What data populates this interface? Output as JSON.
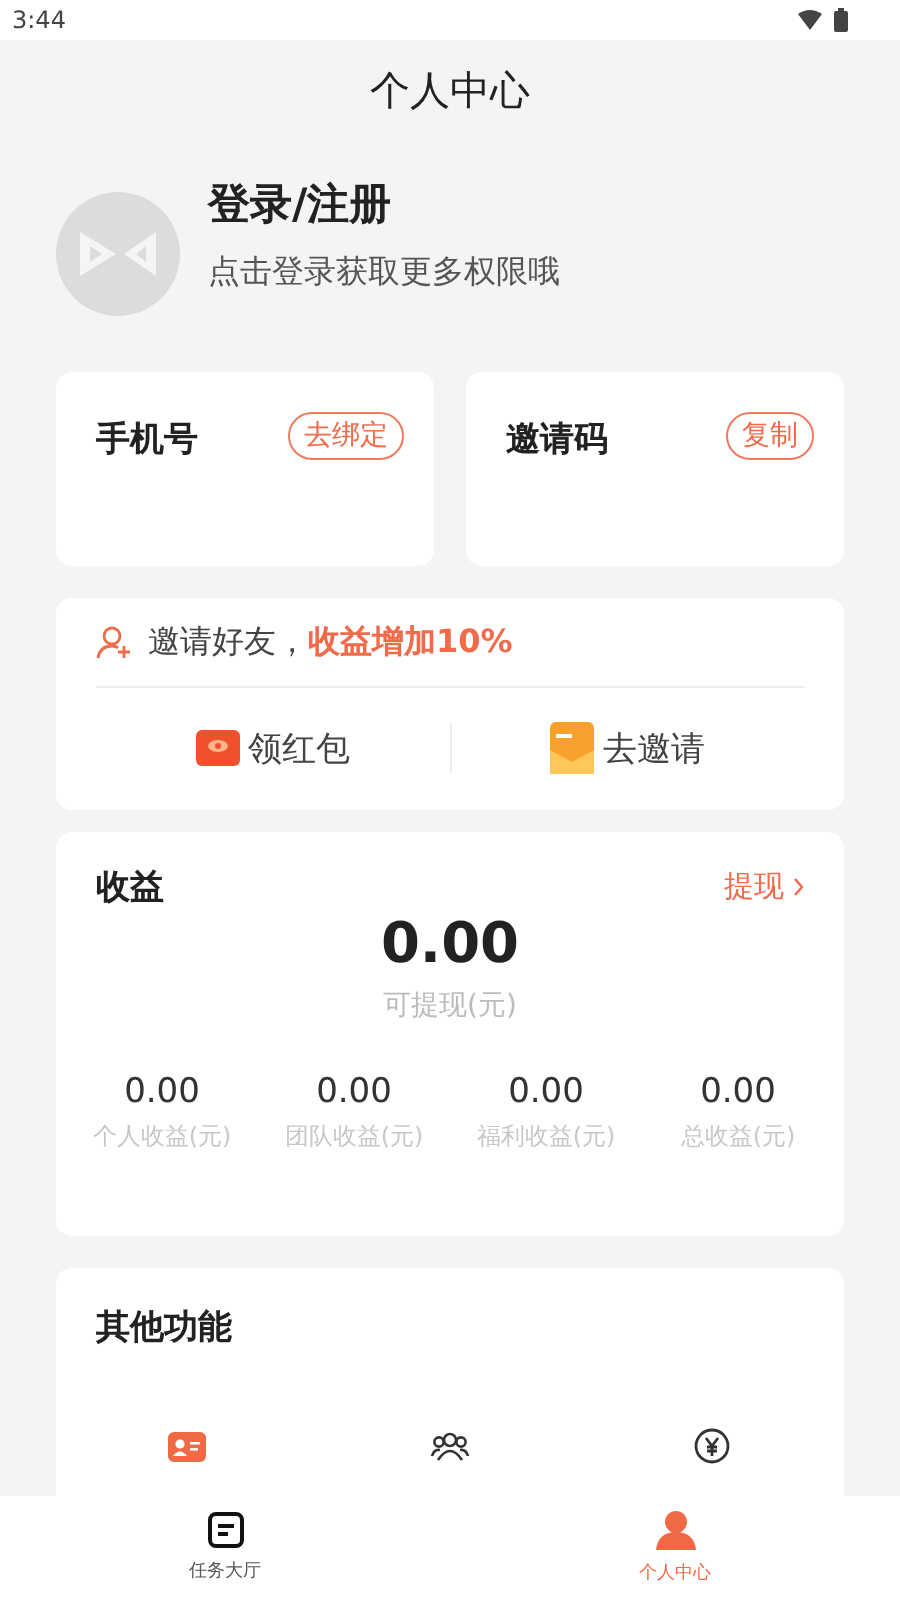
{
  "status_bar": {
    "time": "3:44"
  },
  "header": {
    "title": "个人中心"
  },
  "profile": {
    "title": "登录/注册",
    "subtitle": "点击登录获取更多权限哦"
  },
  "bind_cards": [
    {
      "label": "手机号",
      "action": "去绑定"
    },
    {
      "label": "邀请码",
      "action": "复制"
    }
  ],
  "invite": {
    "text": "邀请好友，**收益增加10%**",
    "actions": [
      {
        "label": "领红包",
        "kind": "red-packet"
      },
      {
        "label": "去邀请",
        "kind": "envelope"
      }
    ]
  },
  "earnings": {
    "title": "收益",
    "link": "提现",
    "amount": "0.00",
    "amount_label": "可提现(元)",
    "stats": [
      {
        "value": "0.00",
        "label": "个人收益(元)"
      },
      {
        "value": "0.00",
        "label": "团队收益(元)"
      },
      {
        "value": "0.00",
        "label": "福利收益(元)"
      },
      {
        "value": "0.00",
        "label": "总收益(元)"
      }
    ]
  },
  "other": {
    "title": "其他功能",
    "items": [
      {
        "kind": "id-card"
      },
      {
        "kind": "team"
      },
      {
        "kind": "yuan"
      }
    ]
  },
  "tabs": [
    {
      "label": "任务大厅",
      "kind": "tasks",
      "selected": false
    },
    {
      "label": "个人中心",
      "kind": "person",
      "selected": true
    }
  ]
}
